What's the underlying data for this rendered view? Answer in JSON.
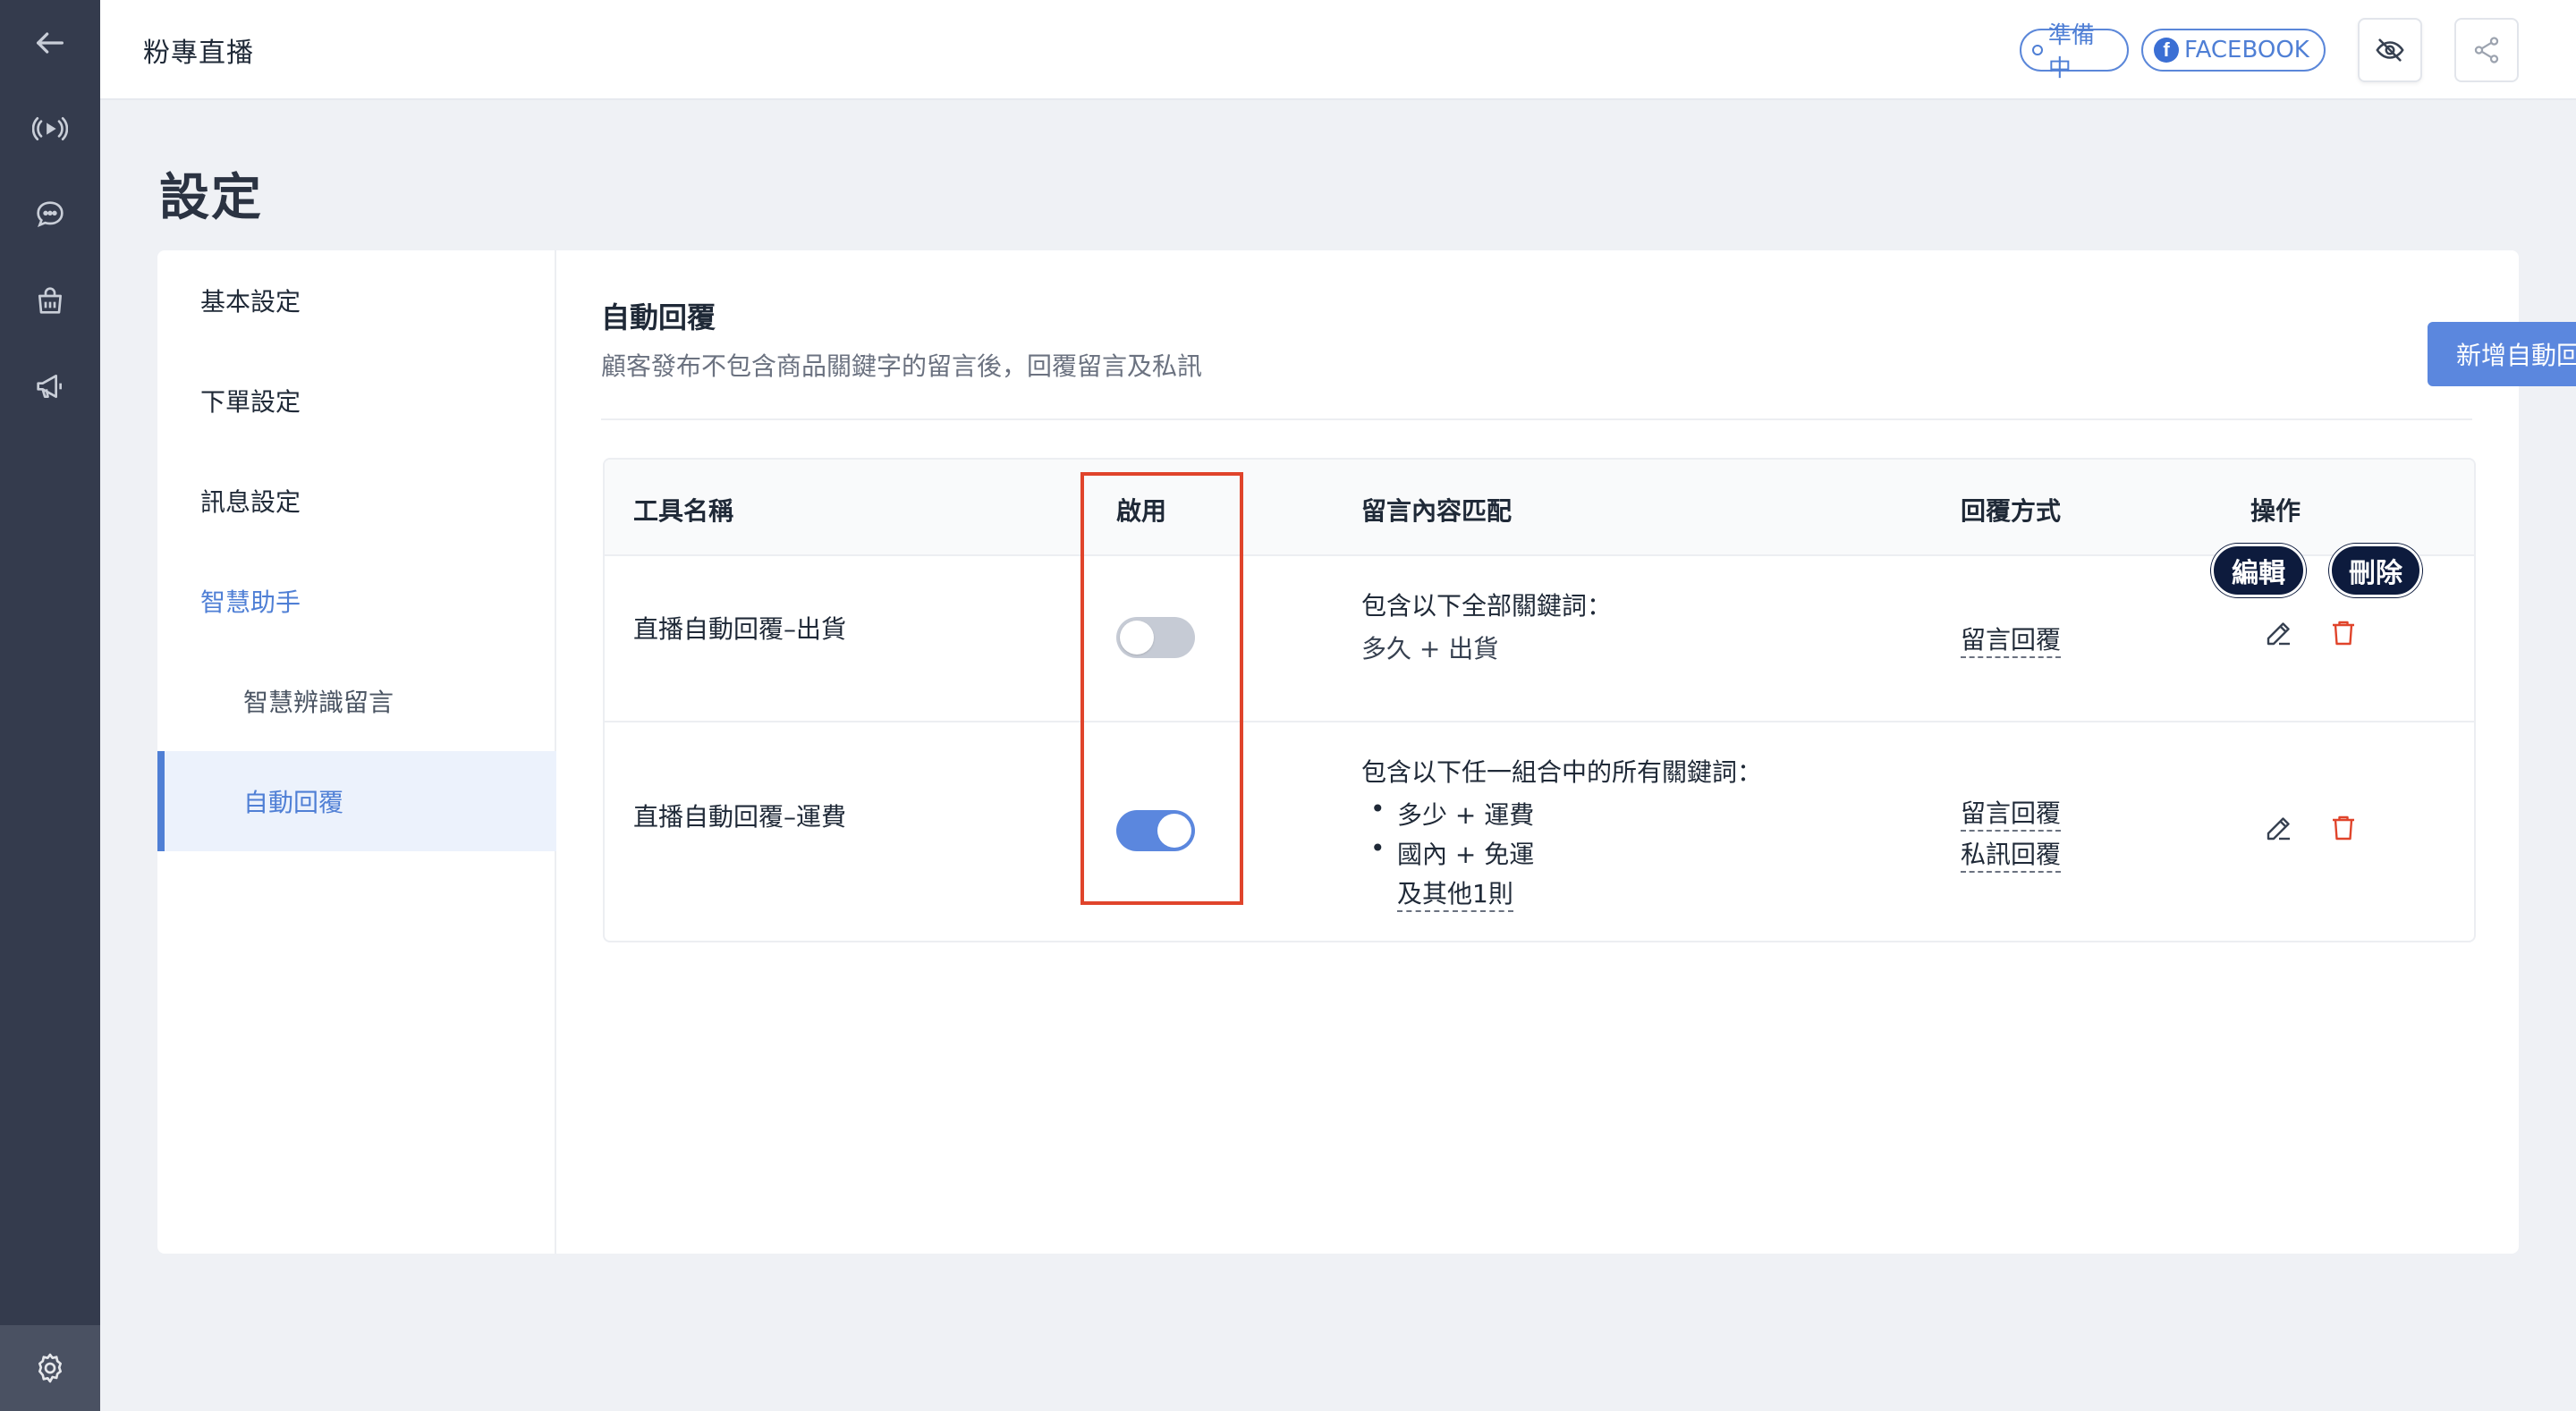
{
  "rail": {
    "items": [
      "back-arrow-icon",
      "broadcast-icon",
      "chat-bubble-icon",
      "shopping-bag-icon",
      "megaphone-icon",
      "gear-icon"
    ]
  },
  "topbar": {
    "title": "粉專直播",
    "status": "準備中",
    "platform": "FACEBOOK"
  },
  "page": {
    "heading": "設定"
  },
  "side_nav": {
    "items": [
      {
        "label": "基本設定"
      },
      {
        "label": "下單設定"
      },
      {
        "label": "訊息設定"
      },
      {
        "label": "智慧助手"
      },
      {
        "label": "智慧辨識留言"
      },
      {
        "label": "自動回覆"
      }
    ]
  },
  "section": {
    "title": "自動回覆",
    "description": "顧客發布不包含商品關鍵字的留言後，回覆留言及私訊",
    "add_button": "新增自動回覆"
  },
  "table": {
    "headers": [
      "工具名稱",
      "啟用",
      "留言內容匹配",
      "回覆方式",
      "操作"
    ],
    "rows": [
      {
        "name": "直播自動回覆–出貨",
        "enabled": false,
        "match_title": "包含以下全部關鍵詞：",
        "match_line": "多久 + 出貨",
        "reply": [
          "留言回覆"
        ]
      },
      {
        "name": "直播自動回覆–運費",
        "enabled": true,
        "match_title": "包含以下任一組合中的所有關鍵詞：",
        "match_items": [
          "多少 + 運費",
          "國內 + 免運"
        ],
        "match_more": "及其他1則",
        "reply": [
          "留言回覆",
          "私訊回覆"
        ]
      }
    ]
  },
  "tooltips": {
    "edit": "編輯",
    "delete": "刪除"
  },
  "colors": {
    "accent": "#5b87de",
    "rail": "#343b4d",
    "danger": "#e0442b",
    "highlight": "#e0442b"
  }
}
